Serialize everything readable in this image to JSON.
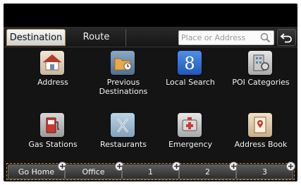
{
  "tabs": [
    {
      "label": "Destination",
      "active": true
    },
    {
      "label": "Route",
      "active": false
    }
  ],
  "search": {
    "placeholder": "Place or Address",
    "icon": "magnifier-icon"
  },
  "back": {
    "icon": "back-arrow-icon"
  },
  "destinations": [
    {
      "label": "Address",
      "icon": "house-icon"
    },
    {
      "label": "Previous Destinations",
      "icon": "folder-icon"
    },
    {
      "label": "Local Search",
      "icon": "google-icon",
      "glyph": "8"
    },
    {
      "label": "POI Categories",
      "icon": "poi-building-icon"
    },
    {
      "label": "Gas Stations",
      "icon": "gas-pump-icon"
    },
    {
      "label": "Restaurants",
      "icon": "fork-knife-icon"
    },
    {
      "label": "Emergency",
      "icon": "ambulance-icon"
    },
    {
      "label": "Address Book",
      "icon": "address-book-icon"
    }
  ],
  "presets": [
    {
      "label": "Go Home"
    },
    {
      "label": "Office"
    },
    {
      "label": "1"
    },
    {
      "label": "2"
    },
    {
      "label": "3"
    }
  ],
  "colors": {
    "accent": "#d08a2a",
    "background": "#141414",
    "tab_active": "#e6e6e6"
  }
}
